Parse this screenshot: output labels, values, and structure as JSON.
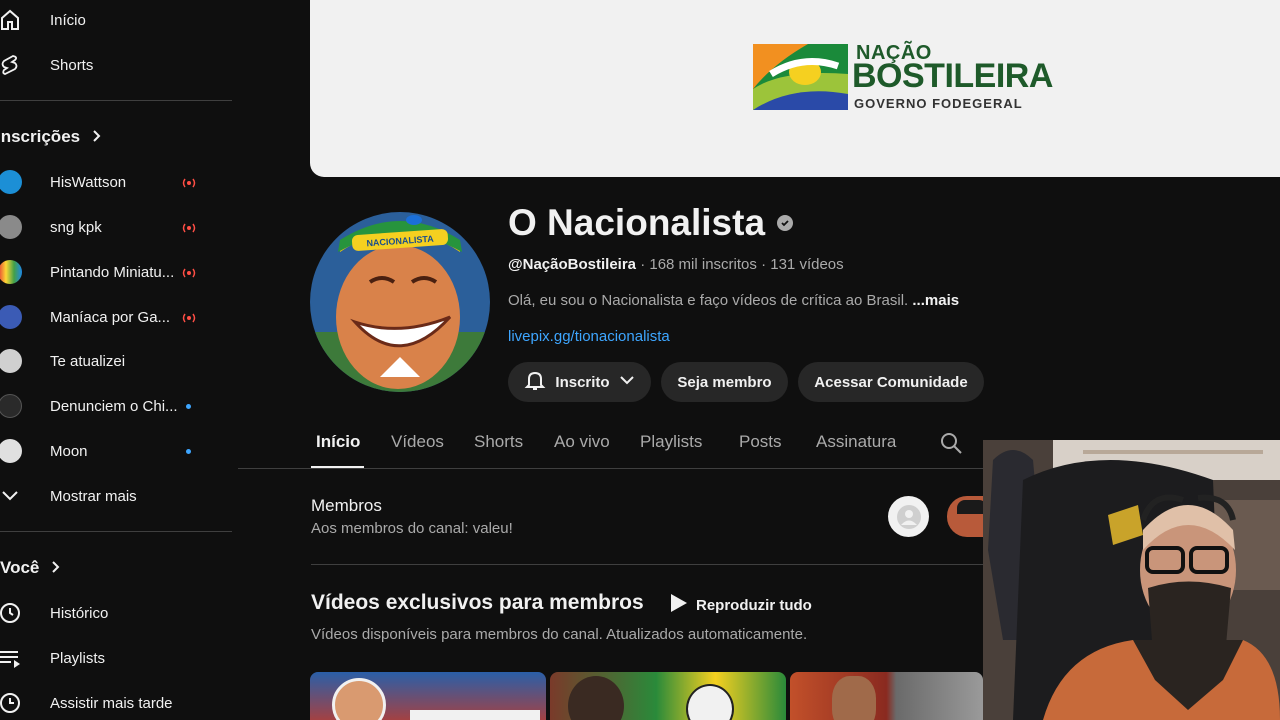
{
  "sidebar": {
    "home_label": "Início",
    "shorts_label": "Shorts",
    "subscriptions_heading": "Inscrições",
    "subscriptions": [
      {
        "label": "HisWattson",
        "status": "live"
      },
      {
        "label": "sng kpk",
        "status": "live"
      },
      {
        "label": "Pintando Miniatu...",
        "status": "live"
      },
      {
        "label": "Maníaca por Ga...",
        "status": "live"
      },
      {
        "label": "Te atualizei",
        "status": "none"
      },
      {
        "label": "Denunciem o Chi...",
        "status": "new"
      },
      {
        "label": "Moon",
        "status": "new"
      }
    ],
    "show_more_label": "Mostrar mais",
    "you_heading": "Você",
    "you_items": [
      {
        "label": "Histórico",
        "icon": "history-icon"
      },
      {
        "label": "Playlists",
        "icon": "playlists-icon"
      },
      {
        "label": "Assistir mais tarde",
        "icon": "watch-later-icon"
      }
    ]
  },
  "banner": {
    "logo_line1": "NAÇÃO",
    "logo_line2": "BOSTILEIRA",
    "logo_line3": "GOVERNO FODEGERAL"
  },
  "channel": {
    "name": "O Nacionalista",
    "handle": "@NaçãoBostileira",
    "subscribers": "168 mil inscritos",
    "video_count": "131 vídeos",
    "description": "Olá, eu sou o Nacionalista e faço vídeos de crítica ao Brasil.",
    "more_label": "...mais",
    "link": "livepix.gg/tionacionalista",
    "avatar_cap_text": "NACIONALISTA",
    "subscribed_label": "Inscrito",
    "join_label": "Seja membro",
    "community_label": "Acessar Comunidade"
  },
  "tabs": [
    "Início",
    "Vídeos",
    "Shorts",
    "Ao vivo",
    "Playlists",
    "Posts",
    "Assinatura"
  ],
  "active_tab": "Início",
  "members": {
    "title": "Membros",
    "subtitle": "Aos membros do canal: valeu!"
  },
  "exclusive": {
    "title": "Vídeos exclusivos para membros",
    "play_all_label": "Reproduzir tudo",
    "subtitle": "Vídeos disponíveis para membros do canal. Atualizados automaticamente."
  },
  "colors": {
    "background": "#0f0f0f",
    "link": "#3ea6ff",
    "live": "#ff4e45",
    "button_bg": "#272727"
  }
}
